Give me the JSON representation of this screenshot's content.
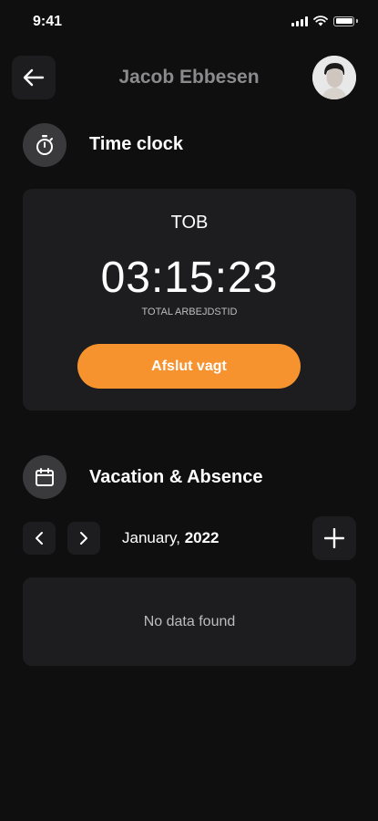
{
  "status_bar": {
    "time": "9:41"
  },
  "header": {
    "title": "Jacob Ebbesen"
  },
  "time_clock": {
    "section_title": "Time clock",
    "label": "TOB",
    "elapsed": "03:15:23",
    "elapsed_caption": "TOTAL ARBEJDSTID",
    "end_shift_label": "Afslut vagt"
  },
  "vacation": {
    "section_title": "Vacation & Absence",
    "month": "January,",
    "year": "2022",
    "empty_message": "No data found"
  },
  "colors": {
    "accent": "#f7932f",
    "background": "#0f0f10",
    "card": "#1d1d1f"
  }
}
